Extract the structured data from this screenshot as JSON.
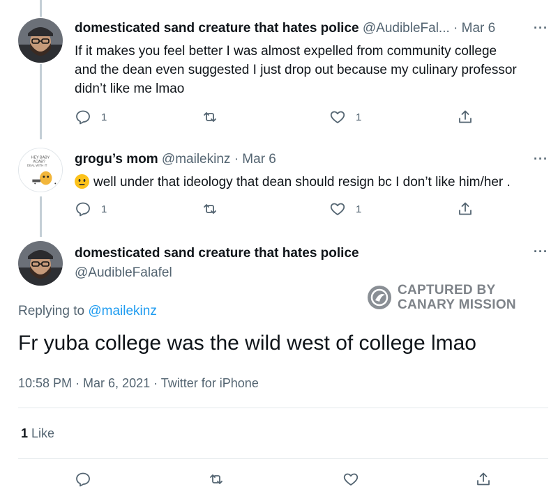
{
  "tweet1": {
    "name": "domesticated sand creature that hates police",
    "handle": "@AudibleFal...",
    "date_separator": "·",
    "date": "Mar 6",
    "text_lines": [
      "If it makes you feel better I was almost expelled from community college",
      "and the dean even suggested I just drop out because my culinary professor",
      "didn’t like me lmao"
    ],
    "reply_count": "1",
    "retweet_count": "",
    "like_count": "1"
  },
  "tweet2": {
    "name": "grogu’s mom",
    "handle": "@mailekinz",
    "date_separator": "·",
    "date": "Mar 6",
    "emoji": "neutral-face-emoji",
    "text": "well under that ideology that dean should resign bc I don’t like him/her .",
    "reply_count": "1",
    "retweet_count": "",
    "like_count": "1",
    "avatar_text": [
      "HEY BABY",
      "ACAB?",
      "DEAL WITH IT"
    ]
  },
  "main_tweet": {
    "name": "domesticated sand creature that hates police",
    "handle": "@AudibleFalafel",
    "replying_prefix": "Replying to",
    "replying_handle": "@mailekinz",
    "text": "Fr yuba college was the wild west of college lmao",
    "timestamp": "10:58 PM · Mar 6, 2021 · Twitter for iPhone",
    "like_count": "1",
    "like_label": "Like"
  },
  "more_glyph": "···",
  "watermark": {
    "line1": "CAPTURED BY",
    "line2": "CANARY MISSION"
  },
  "colors": {
    "text": "#0f1419",
    "secondary": "#536471",
    "link": "#1d9bf0",
    "thread_line": "#c4cfd6",
    "divider": "#e4e9ec",
    "watermark": "#7e8389"
  }
}
